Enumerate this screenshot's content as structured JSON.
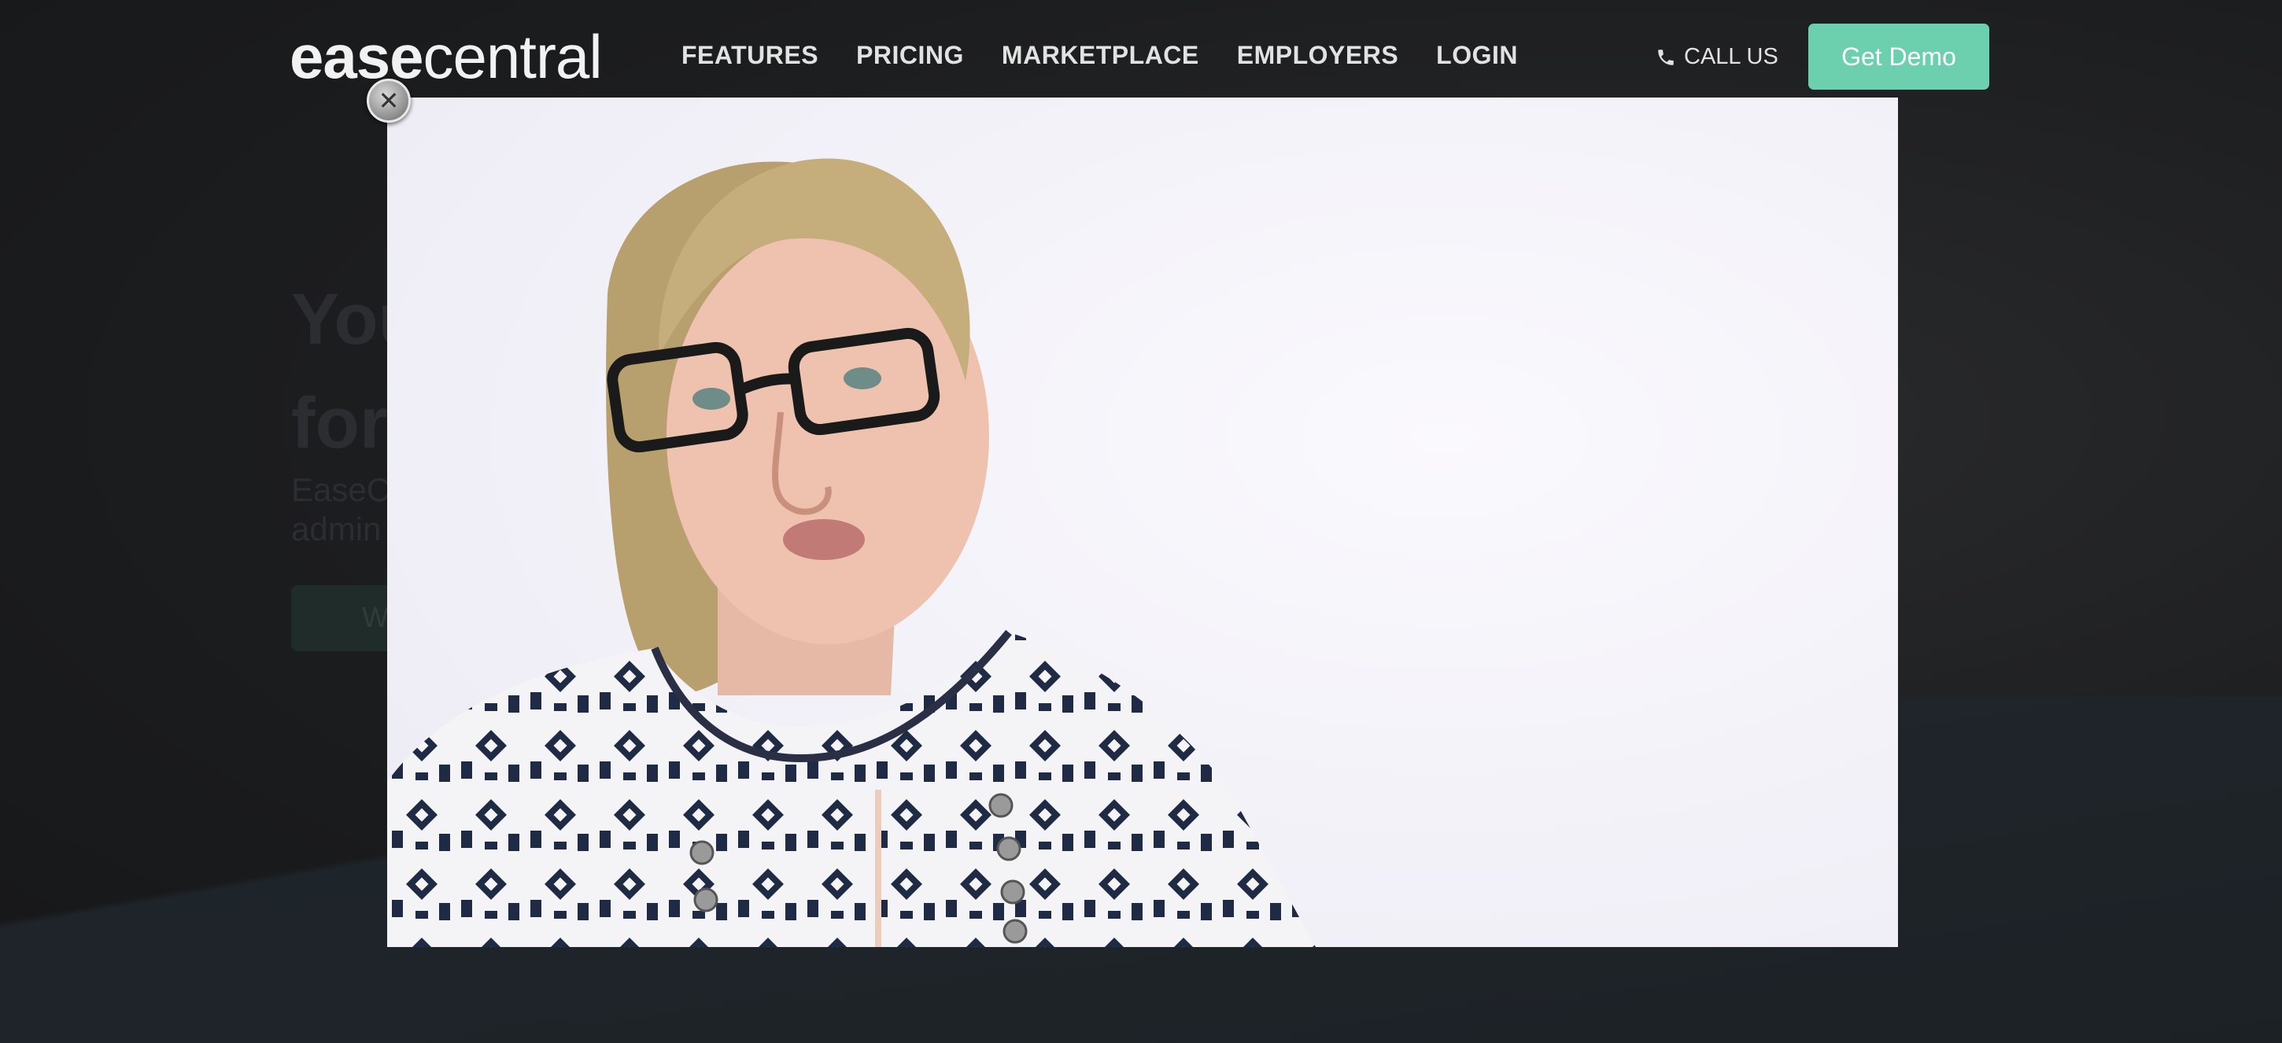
{
  "nav": {
    "logo_part1": "ease",
    "logo_part2": "central",
    "items": [
      {
        "label": "FEATURES"
      },
      {
        "label": "PRICING"
      },
      {
        "label": "MARKETPLACE"
      },
      {
        "label": "EMPLOYERS"
      },
      {
        "label": "LOGIN"
      }
    ],
    "call_label": "CALL US",
    "demo_label": "Get Demo"
  },
  "background": {
    "headline_line1": "You",
    "headline_line2": "for",
    "sub_line1": "EaseCe",
    "sub_line2": "admin"
  },
  "video": {
    "close_glyph": "✕"
  },
  "colors": {
    "accent": "#6ccfae",
    "overlay": "#1a1b1c",
    "video_bg": "#f3f1f8",
    "shirt_pattern": "#1f2a44"
  }
}
